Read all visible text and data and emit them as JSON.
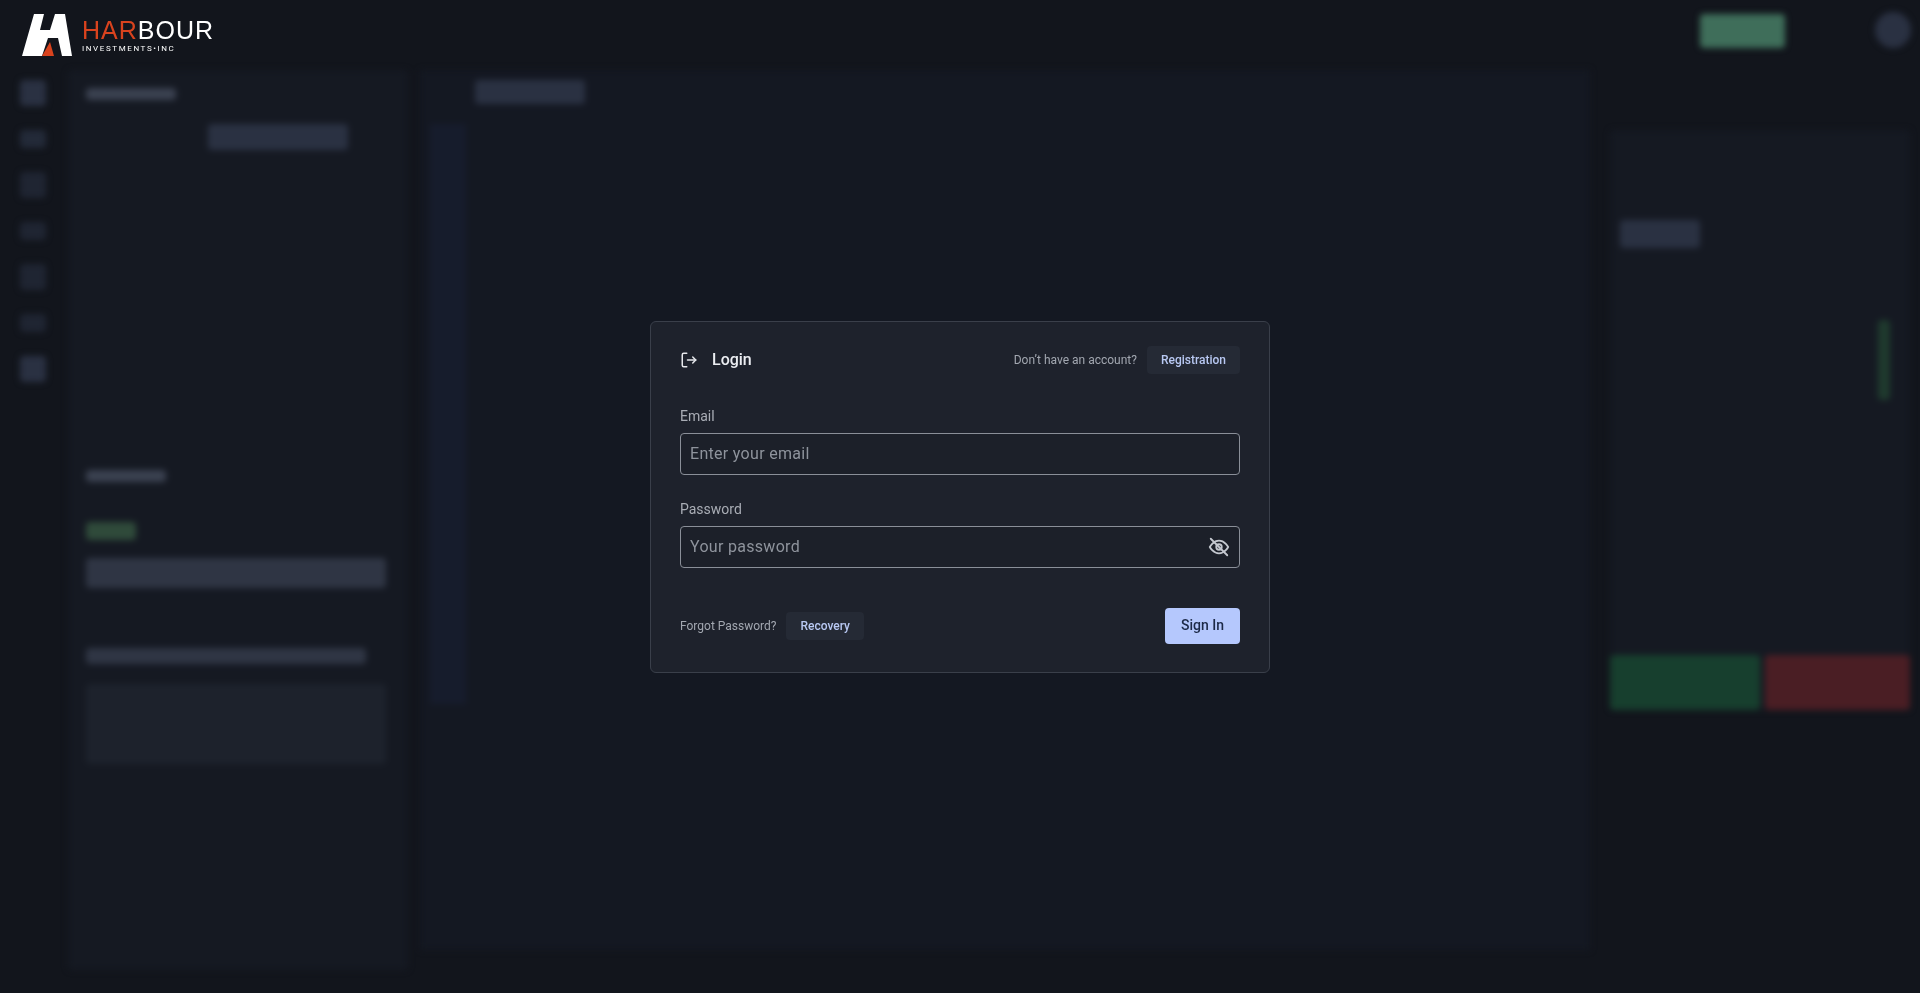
{
  "logo": {
    "name_accent": "HAR",
    "name_rest": "BOUR",
    "tagline": "INVESTMENTS•INC"
  },
  "login": {
    "title": "Login",
    "signup_prompt": "Don’t have an account?",
    "signup_button": "Registration",
    "fields": [
      {
        "kind": "email",
        "label": "Email",
        "placeholder": "Enter your email"
      },
      {
        "kind": "password",
        "label": "Password",
        "placeholder": "Your password"
      }
    ],
    "forgot_prompt": "Forgot Password?",
    "recovery_button": "Recovery",
    "submit_button": "Sign In"
  }
}
